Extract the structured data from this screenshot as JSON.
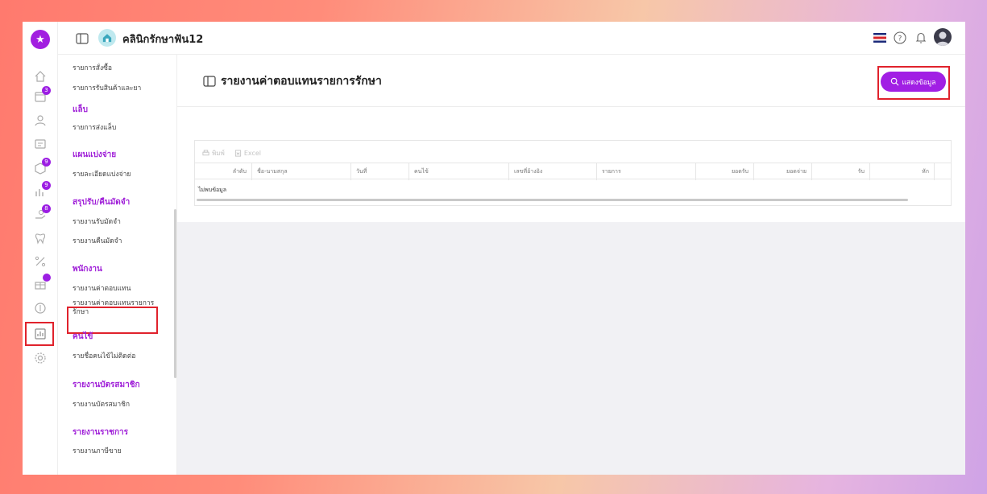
{
  "app": {
    "clinic_name": "คลินิกรักษาฟัน12",
    "accent": "#a11fe4",
    "highlight_color": "#e0222c"
  },
  "rail": {
    "badges": [
      "3",
      "9",
      "9",
      "8",
      ""
    ],
    "icons": [
      "logo-star-icon",
      "home-icon",
      "calendar-icon",
      "user-icon",
      "id-card-icon",
      "box-icon",
      "chart-bars-icon",
      "hand-coin-icon",
      "tooth-icon",
      "percent-icon",
      "gift-icon",
      "money-icon",
      "report-icon",
      "settings-icon"
    ]
  },
  "submenu": {
    "item_order": "รายการสั่งซื้อ",
    "item_receive": "รายการรับสินค้าและยา",
    "head_lab": "แล็บ",
    "item_lab": "รายการส่งแล็บ",
    "head_plan": "แผนแบ่งจ่าย",
    "item_plan": "รายละเอียดแบ่งจ่าย",
    "head_deposit": "สรุปรับ/คืนมัดจำ",
    "item_deposit_in": "รายงานรับมัดจำ",
    "item_deposit_out": "รายงานคืนมัดจำ",
    "head_staff": "พนักงาน",
    "item_staff_pay": "รายงานค่าตอบแทน",
    "item_staff_treat": "รายงานค่าตอบแทนรายการรักษา",
    "head_patient": "คนไข้",
    "item_patient": "รายชื่อคนไข้ไม่ติดต่อ",
    "head_member": "รายงานบัตรสมาชิก",
    "item_member": "รายงานบัตรสมาชิก",
    "head_tax": "รายงานราชการ",
    "item_tax": "รายงานภาษีขาย"
  },
  "main": {
    "title": "รายงานค่าตอบแทนรายการรักษา",
    "show_button": "แสดงข้อมูล",
    "print_label": "พิมพ์",
    "excel_label": "Excel",
    "columns": [
      "ลำดับ",
      "ชื่อ-นามสกุล",
      "วันที่",
      "คนไข้",
      "เลขที่อ้างอิง",
      "รายการ",
      "ยอดรับ",
      "ยอดจ่าย",
      "รับ",
      "หัก"
    ],
    "no_data": "ไม่พบข้อมูล"
  }
}
